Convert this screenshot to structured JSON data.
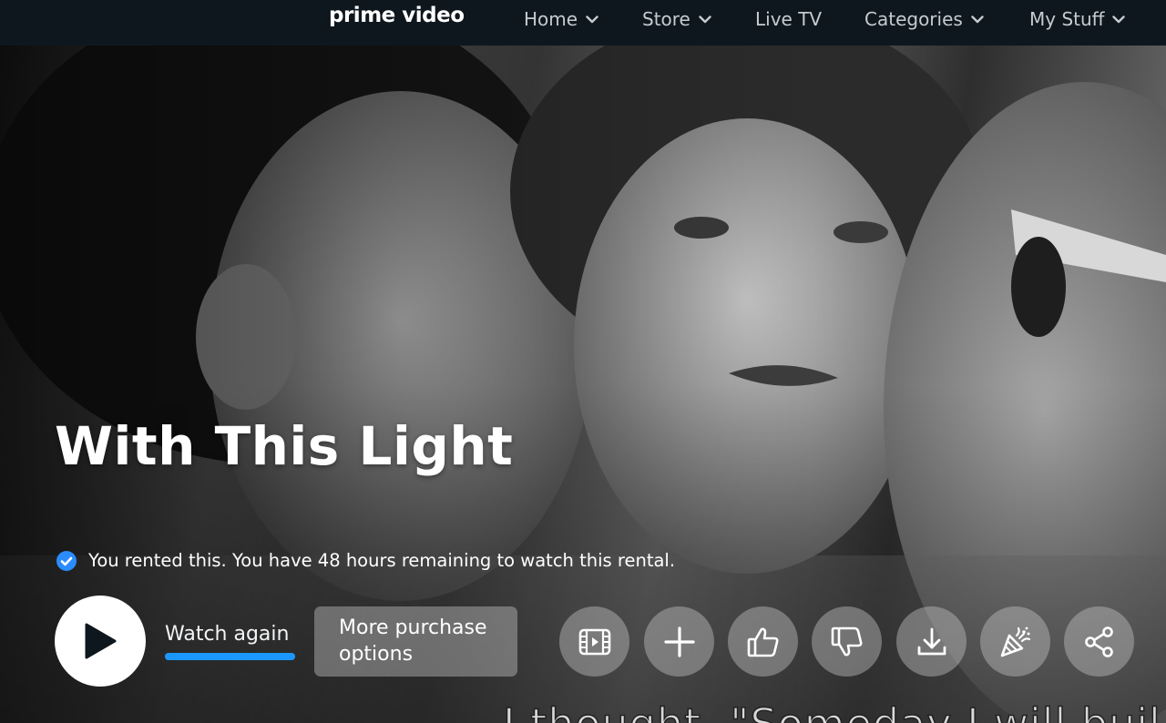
{
  "nav": {
    "logo": "prime video",
    "items": [
      {
        "label": "Home",
        "has_dropdown": true
      },
      {
        "label": "Store",
        "has_dropdown": true
      },
      {
        "label": "Live TV",
        "has_dropdown": false
      },
      {
        "label": "Categories",
        "has_dropdown": true
      },
      {
        "label": "My Stuff",
        "has_dropdown": true
      }
    ]
  },
  "hero": {
    "title": "With This Light",
    "rental_status": "You rented this. You have 48 hours remaining to watch this rental.",
    "watch_label": "Watch again",
    "watch_progress": 1.0,
    "more_options_line1": "More purchase",
    "more_options_line2": "options",
    "subtitle": "I thought, \"Someday I will buil"
  },
  "actions": [
    {
      "name": "trailer",
      "icon": "trailer-icon"
    },
    {
      "name": "add-to-watchlist",
      "icon": "plus-icon"
    },
    {
      "name": "like",
      "icon": "thumbs-up-icon"
    },
    {
      "name": "dislike",
      "icon": "thumbs-down-icon"
    },
    {
      "name": "download",
      "icon": "download-icon"
    },
    {
      "name": "watch-party",
      "icon": "party-popper-icon"
    },
    {
      "name": "share",
      "icon": "share-icon"
    }
  ],
  "colors": {
    "nav_bg": "#0f171e",
    "accent_blue": "#1a98ff",
    "check_blue": "#2b8cff"
  }
}
